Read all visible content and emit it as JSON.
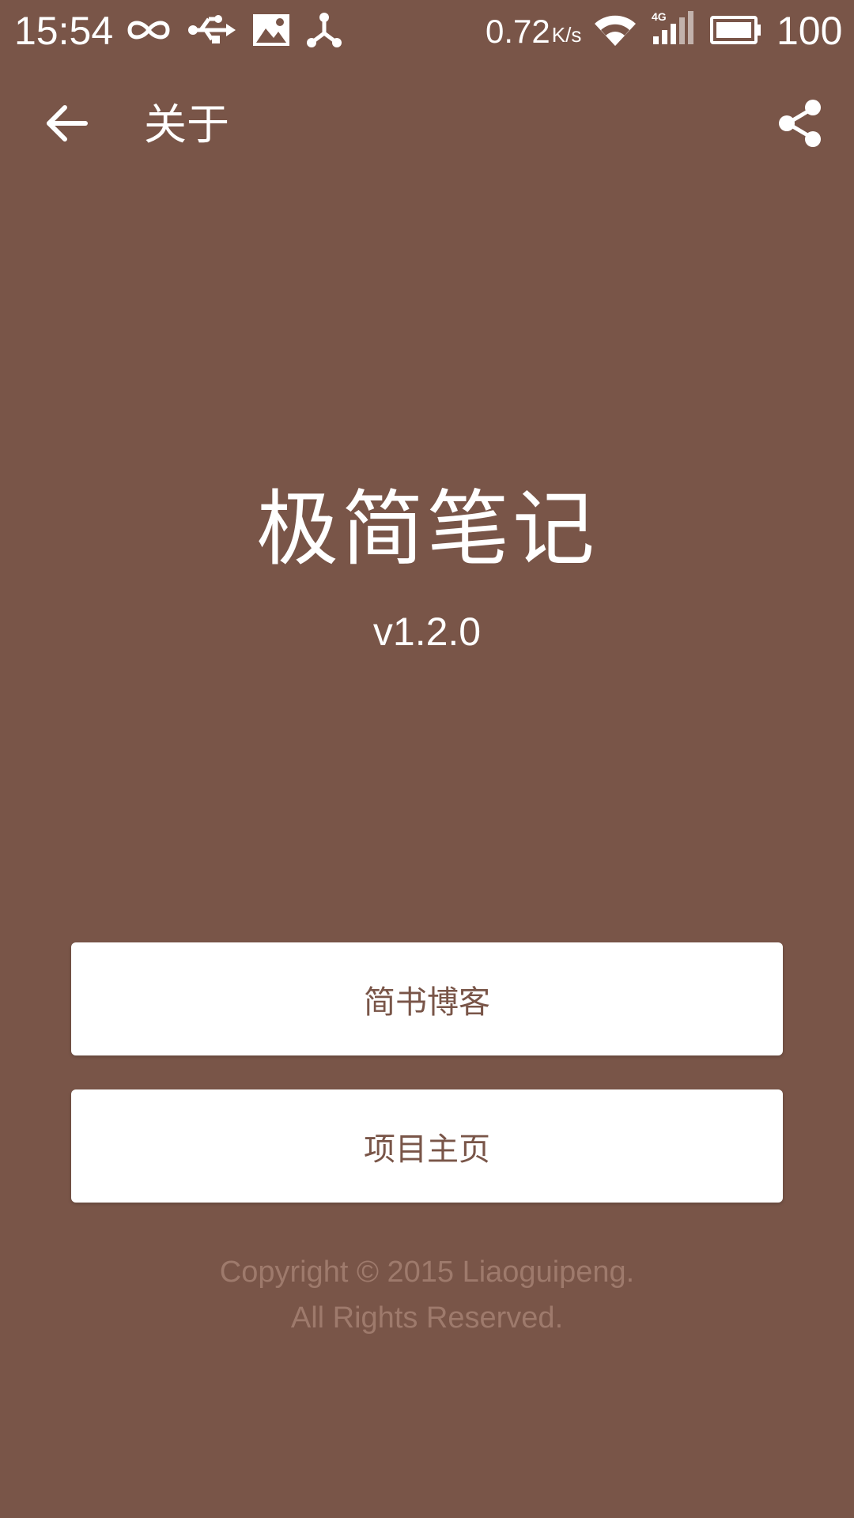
{
  "status_bar": {
    "time": "15:54",
    "icons": [
      "infinity-icon",
      "usb-icon",
      "image-icon",
      "share-network-icon",
      "wifi-icon",
      "signal-4g-icon",
      "battery-icon"
    ],
    "network_speed": "0.72",
    "network_speed_unit": "K/s",
    "battery_percent": "100"
  },
  "app_bar": {
    "title": "关于",
    "back_icon": "arrow-left-icon",
    "share_icon": "share-icon"
  },
  "main": {
    "app_name": "极简笔记",
    "version": "v1.2.0",
    "buttons": [
      {
        "label": "简书博客"
      },
      {
        "label": "项目主页"
      }
    ],
    "copyright_line1": "Copyright © 2015 Liaoguipeng.",
    "copyright_line2": "All Rights Reserved."
  },
  "colors": {
    "background": "#795548",
    "button_background": "#ffffff",
    "button_text": "#795548",
    "copyright_text": "#9e7a6c"
  }
}
